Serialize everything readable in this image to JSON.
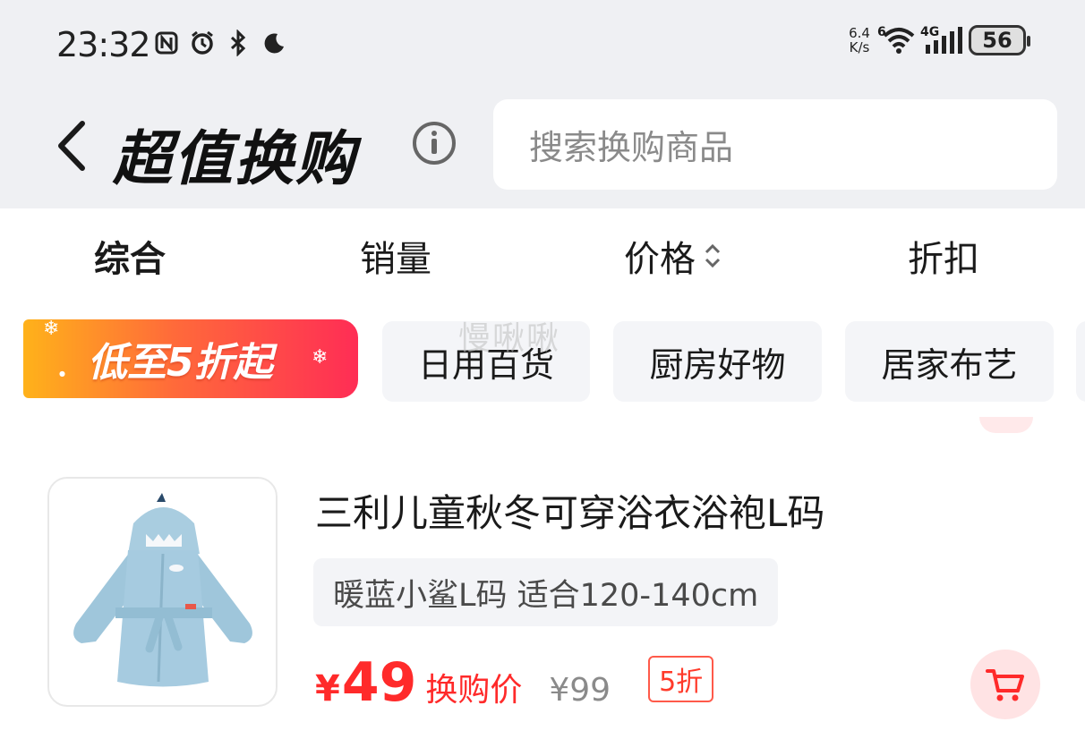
{
  "status_bar": {
    "time": "23:32",
    "net_speed_value": "6.4",
    "net_speed_unit": "K/s",
    "wifi_label": "6",
    "cell_label": "4G",
    "battery": "56",
    "icons": [
      "nfc-icon",
      "alarm-icon",
      "bluetooth-icon",
      "moon-icon",
      "wifi-icon",
      "signal-icon",
      "battery-icon"
    ]
  },
  "header": {
    "title": "超值换购",
    "search_placeholder": "搜索换购商品"
  },
  "sort_tabs": [
    {
      "label": "综合"
    },
    {
      "label": "销量"
    },
    {
      "label": "价格"
    },
    {
      "label": "折扣"
    }
  ],
  "chips": {
    "promo_label": "低至5折起",
    "watermark": "慢啾啾",
    "items": [
      {
        "label": "日用百货"
      },
      {
        "label": "厨房好物"
      },
      {
        "label": "居家布艺"
      }
    ]
  },
  "product": {
    "title": "三利儿童秋冬可穿浴衣浴袍L码",
    "variant": "暖蓝小鲨L码 适合120-140cm",
    "price_symbol": "¥",
    "price": "49",
    "price_label": "换购价",
    "original_price": "¥99",
    "discount": "5折"
  },
  "colors": {
    "accent_red": "#ff2a2a",
    "header_bg": "#eff0f3",
    "chip_bg": "#f4f5f8",
    "promo_gradient_start": "#ffb21a",
    "promo_gradient_end": "#ff2d55"
  }
}
